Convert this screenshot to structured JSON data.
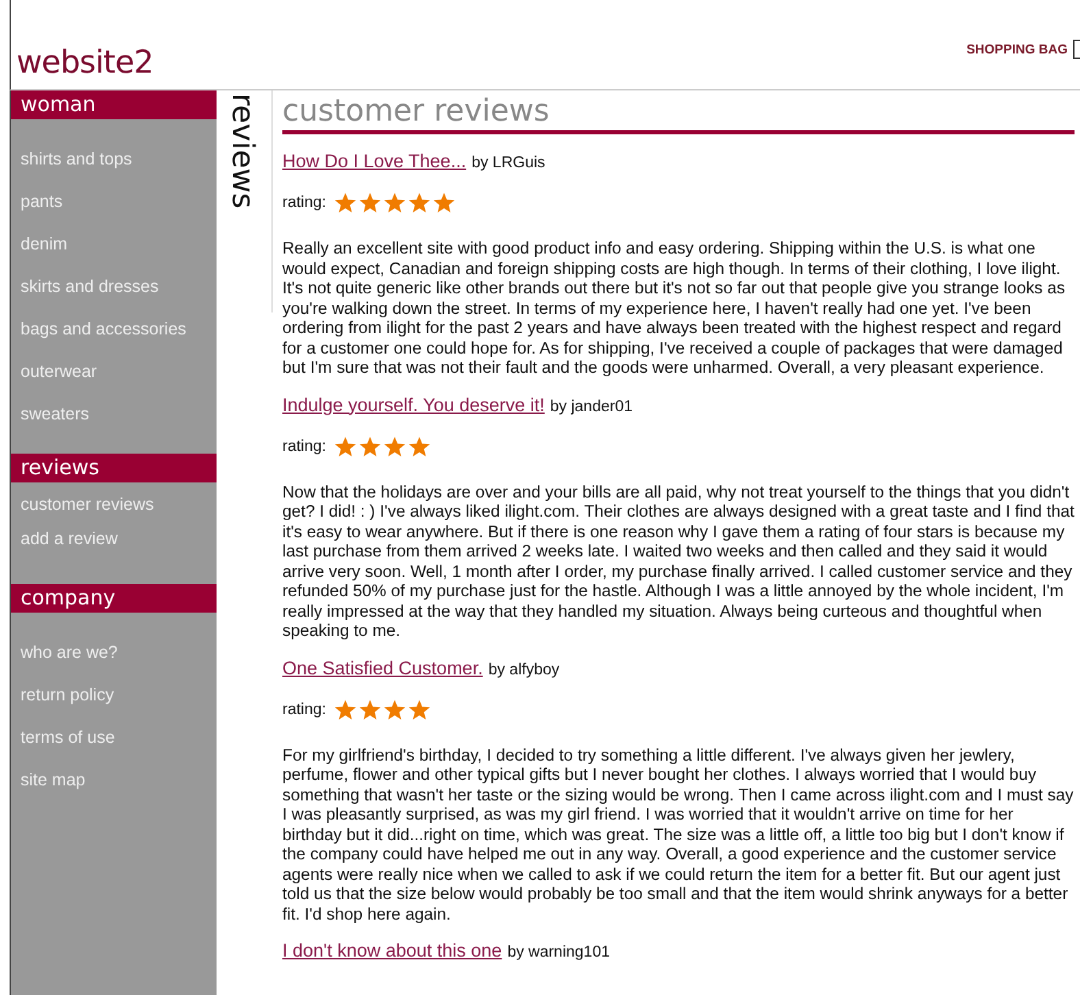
{
  "logo": "website2",
  "header": {
    "shopping_bag": "SHOPPING BAG"
  },
  "sidebar": {
    "sections": [
      {
        "title": "woman",
        "kind": "wide",
        "items": [
          "shirts and tops",
          "pants",
          "denim",
          "skirts and dresses",
          "bags and accessories",
          "outerwear",
          "sweaters"
        ]
      },
      {
        "title": "reviews",
        "kind": "tight",
        "items": [
          "customer reviews",
          "add a review"
        ]
      },
      {
        "title": "company",
        "kind": "wide",
        "items": [
          "who are we?",
          "return policy",
          "terms of use",
          "site map"
        ]
      }
    ]
  },
  "section_label": "reviews",
  "page_title": "customer reviews",
  "reviews": [
    {
      "title": "How Do I Love Thee...",
      "author": "by LRGuis",
      "rating_label": "rating:",
      "stars": 5,
      "text": "Really an excellent site with good product info and easy ordering. Shipping within the U.S. is what one would expect, Canadian and foreign shipping costs are high though.  In terms of their clothing, I love ilight.  It's not quite generic like other brands out there but it's not so far out that people give you strange looks as you're walking down the street.  In terms of my experience here, I haven't really had one yet.  I've been ordering from ilight for the past 2 years and have always been treated with the highest respect and regard for a customer one could hope for.  As for shipping, I've received a couple of packages that were damaged but I'm sure that was not their fault and the goods were unharmed. Overall, a very pleasant experience."
    },
    {
      "title": "Indulge yourself. You deserve it!",
      "author": "by jander01",
      "rating_label": "rating:",
      "stars": 4,
      "text": "Now that the holidays are over and your bills are all paid, why not treat yourself to the things that you didn't get?  I did!  : )  I've always liked ilight.com.  Their clothes are always designed with a great taste and I find that it's easy to wear anywhere.  But if there is one reason why I gave them a rating of four stars is because my last purchase from them arrived 2 weeks late.  I waited two weeks and then called and they said it would arrive very soon.  Well, 1 month after I order, my purchase finally arrived. I called customer service and they refunded 50% of my purchase just for the hastle.  Although I was a little annoyed by the whole incident, I'm really impressed at the way that they handled my situation. Always being curteous and thoughtful when speaking to me."
    },
    {
      "title": "One Satisfied Customer.",
      "author": "by alfyboy",
      "rating_label": "rating:",
      "stars": 4,
      "text": "For my girlfriend's birthday, I decided to try something a little different.  I've always given her jewlery, perfume, flower and other typical gifts but I never bought her clothes.  I always worried that I would buy something that wasn't her taste or the sizing would be wrong.  Then I came across ilight.com and I must say I was pleasantly surprised, as was my girl friend.  I was worried that it wouldn't arrive on time for her birthday but it did...right on time, which was great. The size was a little off, a little too big but I don't know if the company could have helped me out in any way.  Overall, a good experience and the customer service agents were really nice when we called to ask if we could return the item for a better fit.  But our agent just told us that the size below would probably be too small and that the item would shrink anyways for a better fit.  I'd shop here again."
    },
    {
      "title": "I don't know about this one",
      "author": "by warning101"
    }
  ]
}
